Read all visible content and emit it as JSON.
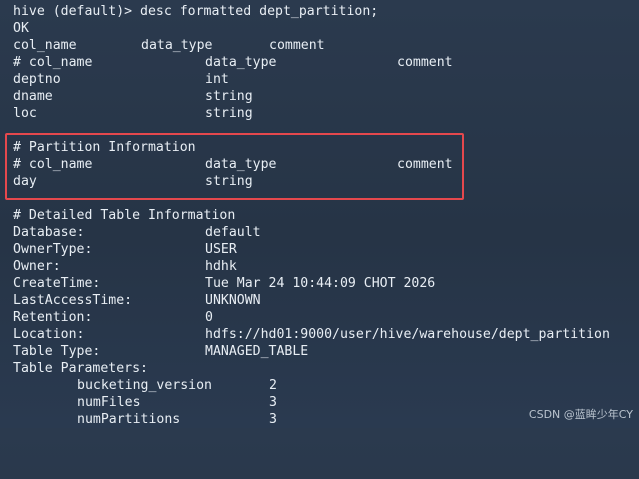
{
  "terminal": {
    "partial_top": "hive (default)> desc formatted dept_partition;",
    "ok": "OK",
    "header_simple": [
      "col_name",
      "data_type",
      "comment"
    ],
    "header_hash": [
      "# col_name",
      "data_type",
      "comment"
    ],
    "columns": [
      {
        "name": "deptno",
        "type": "int"
      },
      {
        "name": "dname",
        "type": "string"
      },
      {
        "name": "loc",
        "type": "string"
      }
    ],
    "partition_title": "# Partition Information",
    "partition_header": [
      "# col_name",
      "data_type",
      "comment"
    ],
    "partition_columns": [
      {
        "name": "day",
        "type": "string"
      }
    ],
    "detailed_title": "# Detailed Table Information",
    "details": [
      {
        "key": "Database:",
        "value": "default"
      },
      {
        "key": "OwnerType:",
        "value": "USER"
      },
      {
        "key": "Owner:",
        "value": "hdhk"
      },
      {
        "key": "CreateTime:",
        "value": "Tue Mar 24 10:44:09 CHOT 2026"
      },
      {
        "key": "LastAccessTime:",
        "value": "UNKNOWN"
      },
      {
        "key": "Retention:",
        "value": "0"
      },
      {
        "key": "Location:",
        "value": "hdfs://hd01:9000/user/hive/warehouse/dept_partition"
      },
      {
        "key": "Table Type:",
        "value": "MANAGED_TABLE"
      }
    ],
    "table_params_title": "Table Parameters:",
    "table_params": [
      {
        "key": "bucketing_version",
        "value": "2"
      },
      {
        "key": "numFiles",
        "value": "3"
      },
      {
        "key": "numPartitions",
        "value": "3"
      }
    ]
  },
  "watermark": "CSDN @蓝眸少年CY",
  "colors": {
    "highlight_border": "#e5484d",
    "text": "#e8eef4"
  }
}
